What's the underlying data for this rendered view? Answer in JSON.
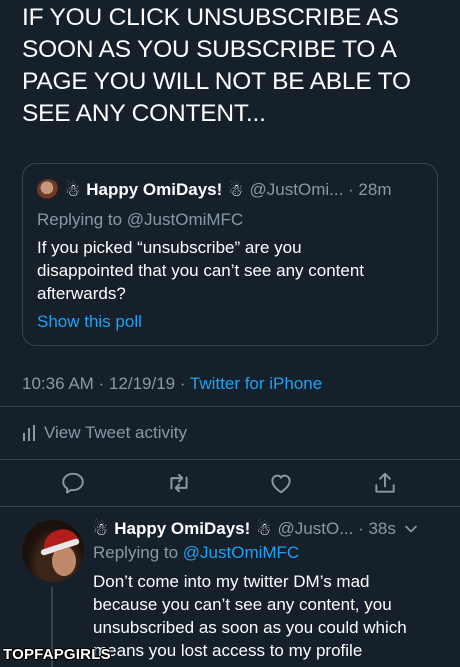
{
  "tweet": {
    "text": "IF YOU CLICK UNSUBSCRIBE AS\nSOON AS YOU SUBSCRIBE TO A\nPAGE YOU WILL NOT BE ABLE TO\nSEE ANY CONTENT...",
    "timestamp": "10:36 AM · 12/19/19 · ",
    "source": "Twitter for iPhone",
    "activity_label": "View Tweet activity"
  },
  "quote": {
    "name": "Happy OmiDays!",
    "handle_time": "@JustOmi... · 28m",
    "replying_prefix": "Replying to ",
    "replying_handle": "@JustOmiMFC",
    "body": "If you picked “unsubscribe” are you\ndisappointed that you can’t see any content\nafterwards?",
    "poll_link": "Show this poll"
  },
  "actions": {
    "icons": [
      "reply-icon",
      "retweet-icon",
      "like-icon",
      "share-icon"
    ]
  },
  "reply": {
    "name": "Happy OmiDays!",
    "handle_time": "@JustO... · 38s",
    "replying_prefix": "Replying to ",
    "replying_handle": "@JustOmiMFC",
    "body": "Don’t come into my twitter DM’s mad\nbecause you can’t see any content, you\nunsubscribed as soon as you could which\nmeans you lost access to my profile"
  },
  "watermark": "TOPFAPGIRLS",
  "colors": {
    "background": "#15202b",
    "secondary_text": "#8899a6",
    "accent": "#1da1f2",
    "border": "#38444d"
  }
}
